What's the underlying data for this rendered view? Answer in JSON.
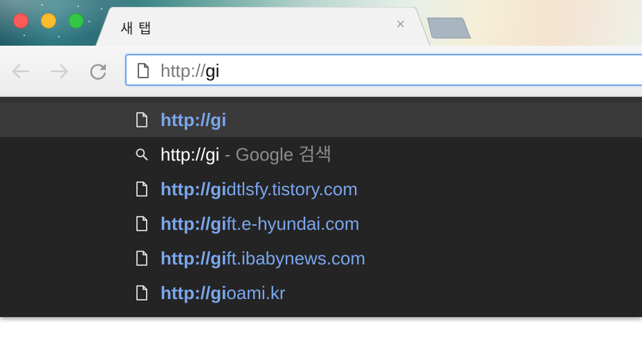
{
  "tab": {
    "title": "새 탭",
    "close_glyph": "×"
  },
  "omnibox": {
    "scheme": "http://",
    "typed": "gi",
    "icon": "page-icon"
  },
  "toolbar": {
    "back_icon": "back-arrow-icon",
    "forward_icon": "forward-arrow-icon",
    "reload_icon": "reload-icon"
  },
  "suggestions": [
    {
      "kind": "url",
      "icon": "page-icon",
      "match": "http://gi",
      "rest": ""
    },
    {
      "kind": "search",
      "icon": "search-icon",
      "query": "http://gi",
      "suffix": " - Google 검색"
    },
    {
      "kind": "url",
      "icon": "page-icon",
      "match": "http://gi",
      "rest": "dtlsfy.tistory.com"
    },
    {
      "kind": "url",
      "icon": "page-icon",
      "match": "http://gi",
      "rest": "ft.e-hyundai.com"
    },
    {
      "kind": "url",
      "icon": "page-icon",
      "match": "http://gi",
      "rest": "ft.ibabynews.com"
    },
    {
      "kind": "url",
      "icon": "page-icon",
      "match": "http://gi",
      "rest": "oami.kr"
    }
  ],
  "colors": {
    "accent": "#6fa4e6",
    "link": "#7aa6ec",
    "dropdown_bg": "#242424",
    "selected_bg": "#3a3a3a"
  }
}
